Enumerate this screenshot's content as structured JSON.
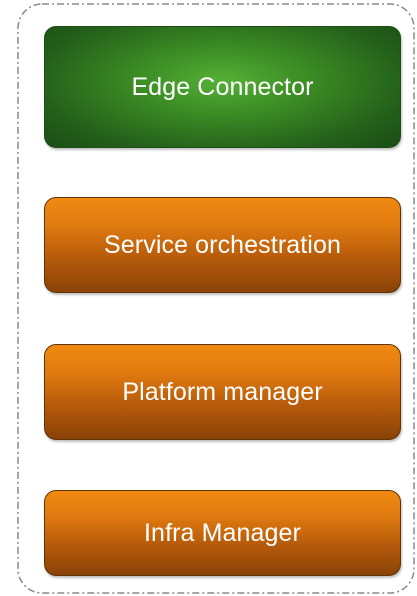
{
  "diagram": {
    "blocks": [
      {
        "id": "edge-connector",
        "label": "Edge Connector",
        "color": "#3d8e25"
      },
      {
        "id": "service-orchestration",
        "label": "Service orchestration",
        "color": "#e07a10"
      },
      {
        "id": "platform-manager",
        "label": "Platform manager",
        "color": "#e07a10"
      },
      {
        "id": "infra-manager",
        "label": "Infra Manager",
        "color": "#e07a10"
      }
    ],
    "container_border_color": "#8a8a8a"
  }
}
